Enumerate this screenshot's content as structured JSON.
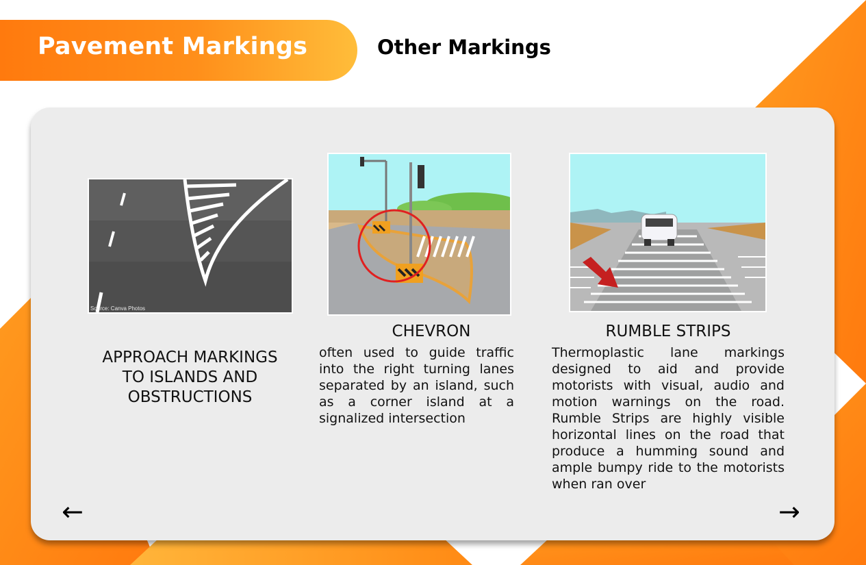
{
  "header": {
    "title": "Pavement Markings"
  },
  "section": {
    "title": "Other Markings"
  },
  "items": [
    {
      "title": "APPROACH MARKINGS TO ISLANDS AND OBSTRUCTIONS",
      "image_credit": "Source: Canva Photos",
      "description": ""
    },
    {
      "title": "CHEVRON",
      "description": "often used to guide traffic into the right turning lanes separated by an island, such as a corner island at a signalized intersection"
    },
    {
      "title": "RUMBLE STRIPS",
      "description": "Thermoplastic lane markings designed to aid and provide motorists with visual, audio and motion warnings on the road. Rumble Strips are highly visible horizontal lines on the road that produce a humming sound and ample bumpy ride to the motorists when ran over"
    }
  ],
  "nav": {
    "prev_icon": "left-arrow-icon",
    "prev_glyph": "←",
    "next_icon": "right-arrow-icon",
    "next_glyph": "→"
  },
  "colors": {
    "accent_orange": "#ff7a0e",
    "accent_yellow": "#ffbd3a",
    "card_bg": "#ececec"
  }
}
